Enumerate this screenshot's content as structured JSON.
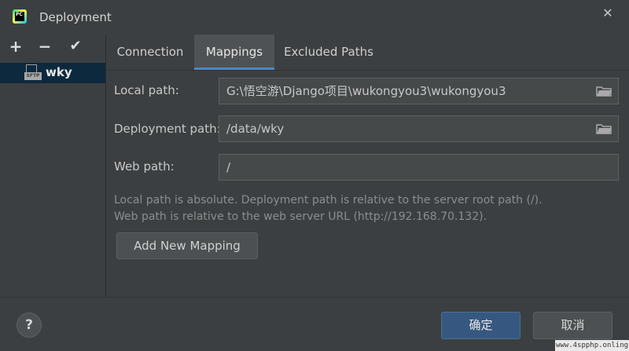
{
  "window": {
    "title": "Deployment",
    "close_glyph": "✕",
    "app_icon_text": "PC"
  },
  "left_panel": {
    "add_glyph": "+",
    "remove_glyph": "−",
    "default_glyph": "✔",
    "server_icon_text": "SFTP",
    "server_name": "wky"
  },
  "tabs": [
    {
      "label": "Connection",
      "active": false
    },
    {
      "label": "Mappings",
      "active": true
    },
    {
      "label": "Excluded Paths",
      "active": false
    }
  ],
  "form": {
    "local_path_label": "Local path:",
    "local_path_value": "G:\\悟空游\\Django项目\\wukongyou3\\wukongyou3",
    "deployment_path_label": "Deployment path:",
    "deployment_path_value": "/data/wky",
    "web_path_label": "Web path:",
    "web_path_value": "/"
  },
  "hints": {
    "line1": "Local path is absolute. Deployment path is relative to the server root path (/).",
    "line2": "Web path is relative to the web server URL (http://192.168.70.132)."
  },
  "add_mapping_label": "Add New Mapping",
  "footer": {
    "help_label": "?",
    "ok_label": "确定",
    "cancel_label": "取消"
  },
  "watermark": "www.4spphp.onling",
  "colors": {
    "background": "#3c3f41",
    "selected_item": "#0d293e",
    "active_tab": "#4e5254",
    "tab_accent": "#4a88c7",
    "ok_button": "#365880"
  },
  "icons": [
    "app-icon",
    "close-icon",
    "add-icon",
    "remove-icon",
    "checkmark-icon",
    "sftp-server-icon",
    "folder-icon",
    "help-icon"
  ]
}
